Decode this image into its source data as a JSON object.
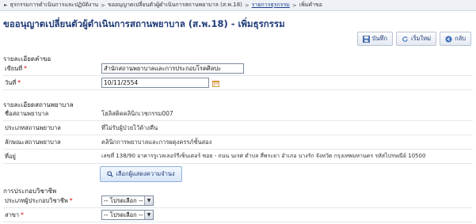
{
  "breadcrumb": {
    "items": [
      "ธุรกรรมการดำเนินการและปฏิบัติงาน",
      "ขออนุญาตเปลี่ยนตัวผู้ดำเนินการสถานพยาบาล (ส.พ.18)",
      "รายการธุรกรรม",
      "เพิ่มคำขอ"
    ],
    "separator": ">"
  },
  "page_title": "ขออนุญาตเปลี่ยนตัวผู้ดำเนินการสถานพยาบาล (ส.พ.18) - เพิ่มธุรกรรม",
  "toolbar": {
    "save_label": "บันทึก",
    "reset_label": "เริ่มใหม่",
    "back_label": "กลับ"
  },
  "request_section": {
    "heading": "รายละเอียดคำขอ",
    "written_at_label": "เขียนที่",
    "written_at_value": "สำนักสถานพยาบาลและการประกอบโรคศิลปะ",
    "date_label": "วันที่",
    "date_value": "10/11/2554",
    "required_mark": "*"
  },
  "facility_section": {
    "heading": "รายละเอียดสถานพยาบาล",
    "rows": [
      {
        "label": "ชื่อสถานพยาบาล",
        "value": "โฮลิสติคคลินิกเวชกรรม007"
      },
      {
        "label": "ประเภทสถานพยาบาล",
        "value": "ที่ไม่รับผู้ป่วยไว้ค้างคืน"
      },
      {
        "label": "ลักษณะสถานพยาบาล",
        "value": "คลินิกการพยาบาลและการผดุงครรภ์ชั้นสอง"
      },
      {
        "label": "ที่อยู่",
        "value": "เลขที่ 138/90 อาคารรูเวลเลอร์รีเซ็นเตอร์ ซอย - ถนน นเรศ ตำบล สี่พระยา อำเภอ บางรัก จังหวัด กรุงเทพมหานคร รหัสไปรษณีย์ 10500"
      }
    ],
    "select_operator_button": "เลือกผู้แสดงความจำนง"
  },
  "profession_section": {
    "heading": "การประกอบวิชาชีพ",
    "type_label": "ประเภทผู้ประกอบวิชาชีพ",
    "type_selected": "-- โปรดเลือก --",
    "branch_label": "สาขา",
    "branch_selected": "-- โปรดเลือก --",
    "required_mark": "*"
  },
  "colors": {
    "title": "#1e3a78",
    "required": "#dd0000",
    "breadcrumb_bg": "#eef1f6"
  }
}
